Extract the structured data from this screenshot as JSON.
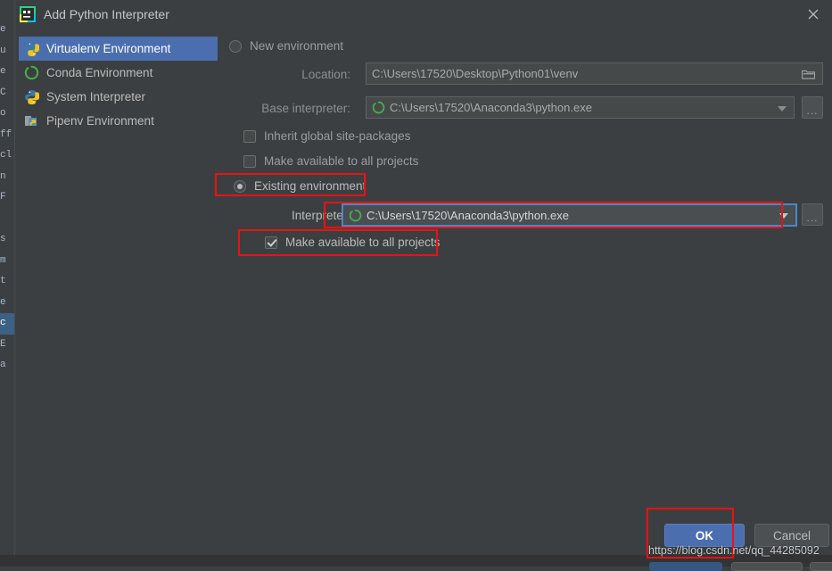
{
  "window": {
    "title": "Add Python Interpreter",
    "app_icon": "pycharm-icon",
    "close_icon": "close-icon"
  },
  "sidebar": {
    "items": [
      {
        "label": "Virtualenv Environment",
        "icon": "virtualenv-python-icon",
        "selected": true
      },
      {
        "label": "Conda Environment",
        "icon": "conda-ring-icon",
        "selected": false
      },
      {
        "label": "System Interpreter",
        "icon": "python-icon",
        "selected": false
      },
      {
        "label": "Pipenv Environment",
        "icon": "pipenv-icon",
        "selected": false
      }
    ]
  },
  "new_environment": {
    "radio_label": "New environment",
    "selected": false,
    "location": {
      "label": "Location:",
      "value": "C:\\Users\\17520\\Desktop\\Python01\\venv",
      "browse_icon": "folder-icon"
    },
    "base_interpreter": {
      "label": "Base interpreter:",
      "value": "C:\\Users\\17520\\Anaconda3\\python.exe",
      "icon": "conda-ring-icon",
      "dropdown_icon": "chevron-down-icon",
      "more_button_label": "..."
    },
    "inherit_global": {
      "label": "Inherit global site-packages",
      "checked": false
    },
    "make_available_new": {
      "label": "Make available to all projects",
      "checked": false
    }
  },
  "existing_environment": {
    "radio_label": "Existing environment",
    "selected": true,
    "interpreter": {
      "label": "Interpreter:",
      "value": "C:\\Users\\17520\\Anaconda3\\python.exe",
      "icon": "conda-ring-icon",
      "dropdown_icon": "chevron-down-icon",
      "more_button_label": "..."
    },
    "make_available": {
      "label": "Make available to all projects",
      "checked": true
    }
  },
  "footer": {
    "ok_label": "OK",
    "cancel_label": "Cancel"
  },
  "annotations": {
    "color": "#ee1111",
    "boxes": [
      "existing-environment-radio",
      "interpreter-combo",
      "make-available-checkbox",
      "ok-button"
    ]
  },
  "watermark": {
    "text": "https://blog.csdn.net/qq_44285092"
  },
  "background_editor": {
    "gutter_chars": "e\nu\ne\nC\no\nff\ncl\nn\nF\n\ns\nm\nt\ne\nc\nE\na"
  },
  "colors": {
    "dialog_bg": "#3c3f41",
    "selection_blue": "#4b6eaf",
    "field_bg": "#45494a",
    "accent_red": "#ee1111",
    "text": "#bbbbbb",
    "text_dim": "#8c8f91"
  }
}
